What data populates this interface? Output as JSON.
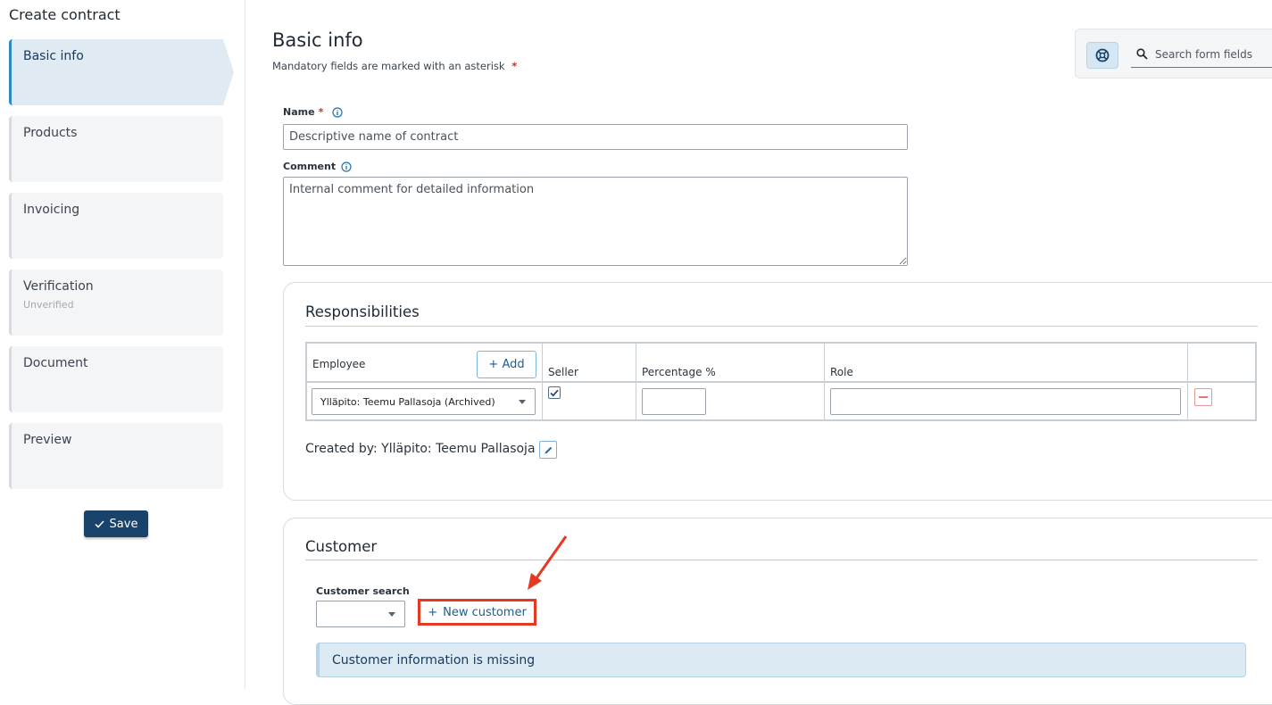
{
  "nav": {
    "title": "Create contract",
    "steps": [
      {
        "label": "Basic info",
        "sub": ""
      },
      {
        "label": "Products",
        "sub": ""
      },
      {
        "label": "Invoicing",
        "sub": ""
      },
      {
        "label": "Verification",
        "sub": "Unverified"
      },
      {
        "label": "Document",
        "sub": ""
      },
      {
        "label": "Preview",
        "sub": ""
      }
    ],
    "save_label": "Save"
  },
  "header": {
    "title": "Basic info",
    "mandatory_note": "Mandatory fields are marked with an asterisk",
    "asterisk": "*"
  },
  "search": {
    "placeholder": "Search form fields"
  },
  "form": {
    "name_label": "Name",
    "name_placeholder": "Descriptive name of contract",
    "comment_label": "Comment",
    "comment_placeholder": "Internal comment for detailed information"
  },
  "responsibilities": {
    "title": "Responsibilities",
    "columns": {
      "employee": "Employee",
      "seller": "Seller",
      "percentage": "Percentage %",
      "role": "Role"
    },
    "add_label": "Add",
    "row": {
      "employee": "Ylläpito: Teemu Pallasoja (Archived)",
      "seller_checked": true,
      "percentage": "",
      "role": ""
    },
    "created_by": "Created by: Ylläpito: Teemu Pallasoja"
  },
  "customer": {
    "title": "Customer",
    "search_label": "Customer search",
    "new_customer_label": "New customer",
    "missing_info": "Customer information is missing"
  },
  "colors": {
    "primary": "#19436b",
    "accent": "#2f8ac4",
    "highlight_box": "#e43a23",
    "required": "#d0302a",
    "info_bg": "#dceaf3"
  }
}
